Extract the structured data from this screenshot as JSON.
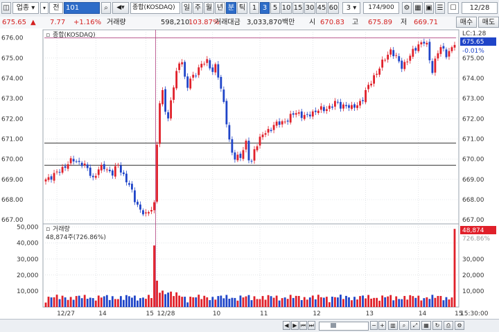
{
  "toolbar": {
    "sector_label": "업종",
    "sector_code": "전",
    "code_value": "101",
    "index_name": "종합(KOSDAQ)",
    "periods": [
      "일",
      "주",
      "월",
      "년",
      "분",
      "틱"
    ],
    "active_period": "분",
    "intervals": [
      "1",
      "3",
      "5",
      "10",
      "15",
      "30",
      "45",
      "60"
    ],
    "active_interval": "3",
    "interval_value": "3",
    "count_value": "174/900",
    "time_value": "12/28"
  },
  "info": {
    "price": "675.65",
    "change": "7.77",
    "change_pct": "+1.16%",
    "volume_label": "거래량",
    "volume": "598,210",
    "volume_pct": "103.87%",
    "amount_label": "거래대금",
    "amount": "3,033,870백만",
    "open_label": "시",
    "open": "670.83",
    "high_label": "고",
    "high": "675.89",
    "low_label": "저",
    "low": "669.71"
  },
  "side_buttons": {
    "buy": "매수",
    "sell": "매도"
  },
  "price_panel": {
    "title": "종합(KOSDAQ)",
    "lc_label": "LC:1.28",
    "current_tag": "675.65",
    "change_tag": "-0.01%",
    "y_ticks": [
      "676.00",
      "675.00",
      "674.00",
      "673.00",
      "672.00",
      "671.00",
      "670.00",
      "669.00",
      "668.00",
      "667.00"
    ],
    "h_levels": [
      676.0,
      670.8,
      669.7
    ]
  },
  "volume_panel": {
    "title": "거래량",
    "value_label": "48,874주(726.86%)",
    "current_tag": "48,874",
    "pct_tag": "726.86%",
    "y_ticks": [
      "50,000",
      "40,000",
      "30,000",
      "20,000",
      "10,000"
    ]
  },
  "x_axis": {
    "labels": [
      "12/27",
      "14",
      "15",
      "12/28",
      "10",
      "11",
      "12",
      "13",
      "14",
      "15"
    ],
    "time_label": "15:30:00"
  },
  "chart_data": {
    "type": "candlestick",
    "title": "종합(KOSDAQ)",
    "interval": "3-minute",
    "sessions": [
      "12/27 13:00-15:30",
      "12/28 09:00-15:30"
    ],
    "price_range": [
      666.8,
      676.4
    ],
    "volume_range": [
      0,
      52000
    ],
    "price_path": [
      [
        0,
        669.0
      ],
      [
        4,
        669.3
      ],
      [
        8,
        669.8
      ],
      [
        10,
        669.95
      ],
      [
        13,
        669.8
      ],
      [
        15,
        669.5
      ],
      [
        17,
        669.05
      ],
      [
        19,
        669.5
      ],
      [
        21,
        669.6
      ],
      [
        24,
        669.3
      ],
      [
        26,
        669.7
      ],
      [
        28,
        669.2
      ],
      [
        30,
        668.7
      ],
      [
        32,
        668.0
      ],
      [
        34,
        667.5
      ],
      [
        36,
        667.2
      ],
      [
        38,
        667.6
      ],
      [
        39,
        667.8
      ],
      [
        40,
        670.8
      ],
      [
        41,
        672.7
      ],
      [
        42,
        673.3
      ],
      [
        43,
        672.5
      ],
      [
        44,
        672.0
      ],
      [
        45,
        672.9
      ],
      [
        46,
        673.6
      ],
      [
        47,
        674.2
      ],
      [
        48,
        674.8
      ],
      [
        49,
        674.9
      ],
      [
        50,
        674.0
      ],
      [
        51,
        673.6
      ],
      [
        52,
        673.9
      ],
      [
        54,
        674.3
      ],
      [
        56,
        674.7
      ],
      [
        58,
        674.8
      ],
      [
        60,
        674.4
      ],
      [
        61,
        674.6
      ],
      [
        62,
        674.1
      ],
      [
        63,
        673.4
      ],
      [
        64,
        672.8
      ],
      [
        65,
        671.9
      ],
      [
        66,
        670.9
      ],
      [
        67,
        670.3
      ],
      [
        68,
        670.0
      ],
      [
        70,
        670.2
      ],
      [
        72,
        670.8
      ],
      [
        73,
        670.0
      ],
      [
        74,
        669.8
      ],
      [
        75,
        670.5
      ],
      [
        76,
        670.8
      ],
      [
        78,
        671.2
      ],
      [
        80,
        671.4
      ],
      [
        82,
        671.7
      ],
      [
        85,
        671.8
      ],
      [
        88,
        672.1
      ],
      [
        90,
        672.3
      ],
      [
        92,
        672.2
      ],
      [
        94,
        672.1
      ],
      [
        96,
        672.3
      ],
      [
        98,
        672.5
      ],
      [
        100,
        672.4
      ],
      [
        102,
        672.6
      ],
      [
        104,
        672.8
      ],
      [
        106,
        672.6
      ],
      [
        108,
        672.7
      ],
      [
        110,
        672.5
      ],
      [
        112,
        672.7
      ],
      [
        114,
        673.0
      ],
      [
        116,
        673.6
      ],
      [
        118,
        674.1
      ],
      [
        120,
        674.5
      ],
      [
        122,
        675.0
      ],
      [
        124,
        675.4
      ],
      [
        126,
        675.0
      ],
      [
        128,
        674.6
      ],
      [
        130,
        674.9
      ],
      [
        132,
        675.3
      ],
      [
        134,
        675.7
      ],
      [
        136,
        675.8
      ],
      [
        137,
        675.6
      ],
      [
        138,
        674.9
      ],
      [
        139,
        674.4
      ],
      [
        140,
        674.9
      ],
      [
        141,
        675.3
      ],
      [
        142,
        675.5
      ],
      [
        144,
        675.2
      ],
      [
        146,
        675.5
      ],
      [
        147,
        675.65
      ]
    ],
    "volume_peaks": [
      {
        "bar": 39,
        "value": 38500
      },
      {
        "bar": 40,
        "value": 16500
      },
      {
        "bar": 147,
        "value": 48874
      }
    ]
  },
  "bottom": {
    "scroll_buttons": [
      "◀",
      "▶",
      "⏮",
      "◀",
      "▶",
      "⏭"
    ]
  },
  "colors": {
    "up": "#e0202a",
    "down": "#1f44c8",
    "grid": "#cfd4da",
    "levelline": "#333333",
    "vline": "#b0407e"
  }
}
